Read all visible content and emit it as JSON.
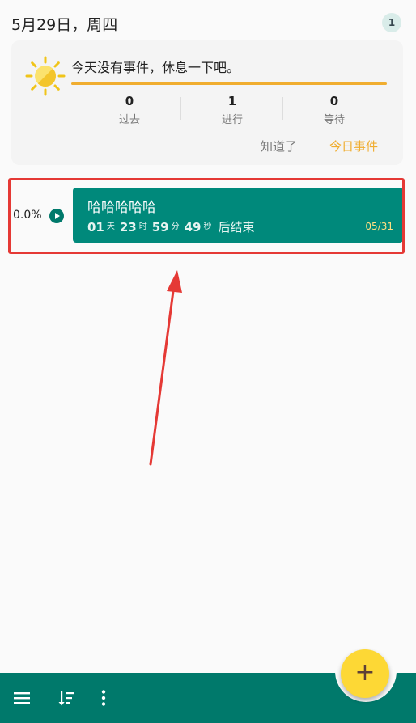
{
  "header": {
    "date": "5月29日，周四",
    "badge": "1"
  },
  "summary": {
    "message": "今天没有事件，休息一下吧。",
    "stats": [
      {
        "value": "0",
        "label": "过去"
      },
      {
        "value": "1",
        "label": "进行"
      },
      {
        "value": "0",
        "label": "等待"
      }
    ],
    "ok_label": "知道了",
    "today_label": "今日事件",
    "accent_color": "#f0ad2f"
  },
  "event": {
    "percent": "0.0%",
    "title": "哈哈哈哈哈",
    "countdown": [
      {
        "value": "01",
        "unit": "天"
      },
      {
        "value": "23",
        "unit": "时"
      },
      {
        "value": "59",
        "unit": "分"
      },
      {
        "value": "49",
        "unit": "秒"
      }
    ],
    "countdown_suffix": "后结束",
    "date": "05/31",
    "color": "#00897b"
  },
  "bottom_bar": {
    "icons": [
      "menu-icon",
      "sort-icon",
      "more-icon"
    ],
    "fab_icon": "add-icon",
    "color": "#00796b",
    "fab_color": "#fdd835"
  }
}
